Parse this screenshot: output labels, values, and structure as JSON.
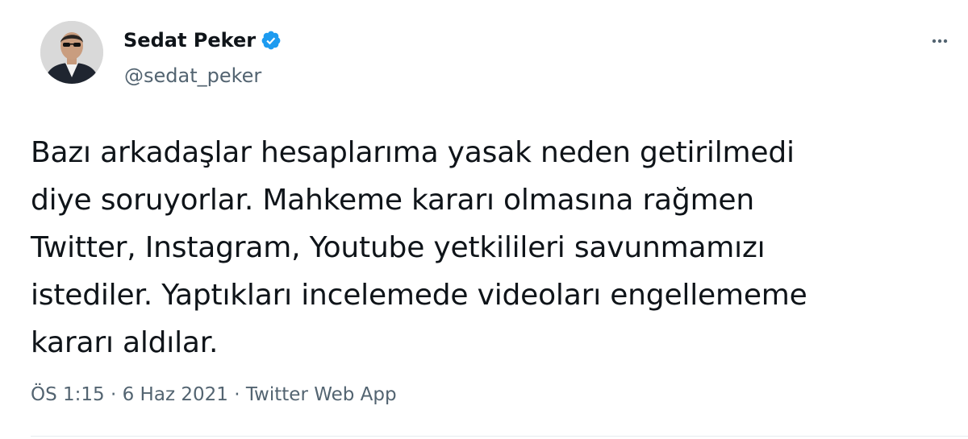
{
  "author": {
    "name": "Sedat Peker",
    "handle": "@sedat_peker",
    "verified": true
  },
  "tweet": {
    "text": "Bazı arkadaşlar hesaplarıma yasak neden getirilmedi\ndiye soruyorlar. Mahkeme kararı olmasına rağmen\nTwitter, Instagram, Youtube yetkilileri savunmamızı\nistediler. Yaptıkları incelemede videoları engellememe\nkararı aldılar.",
    "time": "ÖS 1:15",
    "separator": "·",
    "date": "6 Haz 2021",
    "source": "Twitter Web App"
  },
  "colors": {
    "verified": "#1d9bf0",
    "secondary_text": "#536471",
    "primary_text": "#0f1419"
  },
  "icons": {
    "verified": "verified-badge-icon",
    "more": "more-options-icon"
  }
}
